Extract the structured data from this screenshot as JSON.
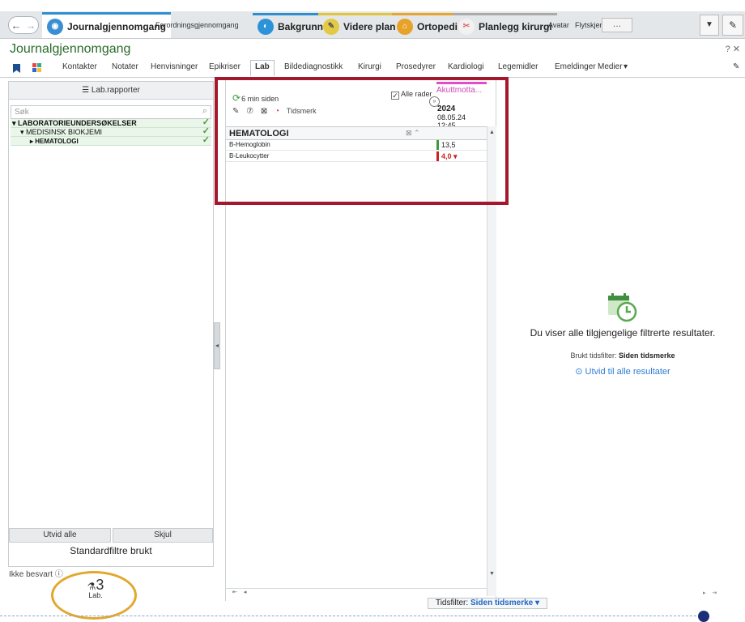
{
  "tabs": [
    {
      "label": "Journalgjennomgang",
      "style": "big active",
      "icon": "journal-tab-icon",
      "color": "#2e8fcf"
    },
    {
      "label": "Forordningsgjennomgang",
      "style": "small",
      "icon": "",
      "color": ""
    },
    {
      "label": "Bakgrunn",
      "style": "big",
      "icon": "background-tab-icon",
      "color": "#2e8fcf"
    },
    {
      "label": "Videre plan",
      "style": "big",
      "icon": "plan-tab-icon",
      "color": "#e2c53a"
    },
    {
      "label": "Ortopedi",
      "style": "big",
      "icon": "ortopedi-tab-icon",
      "color": "#e7a52a"
    },
    {
      "label": "Planlegg kirurgi",
      "style": "big",
      "icon": "kirurgi-tab-icon",
      "color": "#aaaaaa"
    },
    {
      "label": "Avatar",
      "style": "small",
      "icon": "",
      "color": ""
    },
    {
      "label": "Flytskjemaer",
      "style": "small",
      "icon": "",
      "color": ""
    }
  ],
  "tabbar": {
    "more": "…",
    "dropdown": "▼",
    "wrench": "🔧"
  },
  "page_title": "Journalgjennomgang",
  "title_icons": "?  ✕",
  "subnav": [
    "Kontakter",
    "Notater",
    "Henvisninger",
    "Epikriser",
    "Lab",
    "Bildediagnostikk",
    "Kirurgi",
    "Prosedyrer",
    "Kardiologi",
    "Legemidler",
    "Emeldinger",
    "Medier"
  ],
  "subnav_active": "Lab",
  "left": {
    "lab_reports": "☰ Lab.rapporter",
    "search_placeholder": "Søk",
    "tree": [
      {
        "label": "▾ LABORATORIEUNDERSØKELSER",
        "indent": 0
      },
      {
        "label": "▾ MEDISINSK BIOKJEMI",
        "indent": 1
      },
      {
        "label": "▸ HEMATOLOGI",
        "indent": 2
      }
    ],
    "expand_all": "Utvid alle",
    "hide": "Skjul",
    "std_filters": "Standardfiltre brukt"
  },
  "ikke_besvart": "Ikke besvart ⓘ",
  "lab_badge": {
    "count": "3",
    "label": "Lab."
  },
  "lab": {
    "refresh": "6 min siden",
    "tools_time": "Tidsmerk",
    "all_rows": "Alle rader",
    "column_header": "Akuttmotta...",
    "date_year": "2024",
    "date_day": "08.05.24",
    "date_time": "12:45",
    "section": "HEMATOLOGI",
    "rows": [
      {
        "name": "B-Hemoglobin",
        "value": "13,5",
        "abnormal": false
      },
      {
        "name": "B-Leukocytter",
        "value": "4,0 ▾",
        "abnormal": true
      }
    ]
  },
  "right": {
    "msg1": "Du viser alle tilgjengelige filtrerte resultater.",
    "msg2_label": "Brukt tidsfilter:",
    "msg2_value": "Siden tidsmerke",
    "link": "⊙ Utvid til alle resultater"
  },
  "tidsfilter": {
    "label": "Tidsfilter:",
    "value": "Siden tidsmerke ▾"
  },
  "colors": {
    "accent_green": "#2a6b2a",
    "highlight_red": "#a3182c",
    "circle_orange": "#e3a72c",
    "link_blue": "#2d7bd4"
  }
}
